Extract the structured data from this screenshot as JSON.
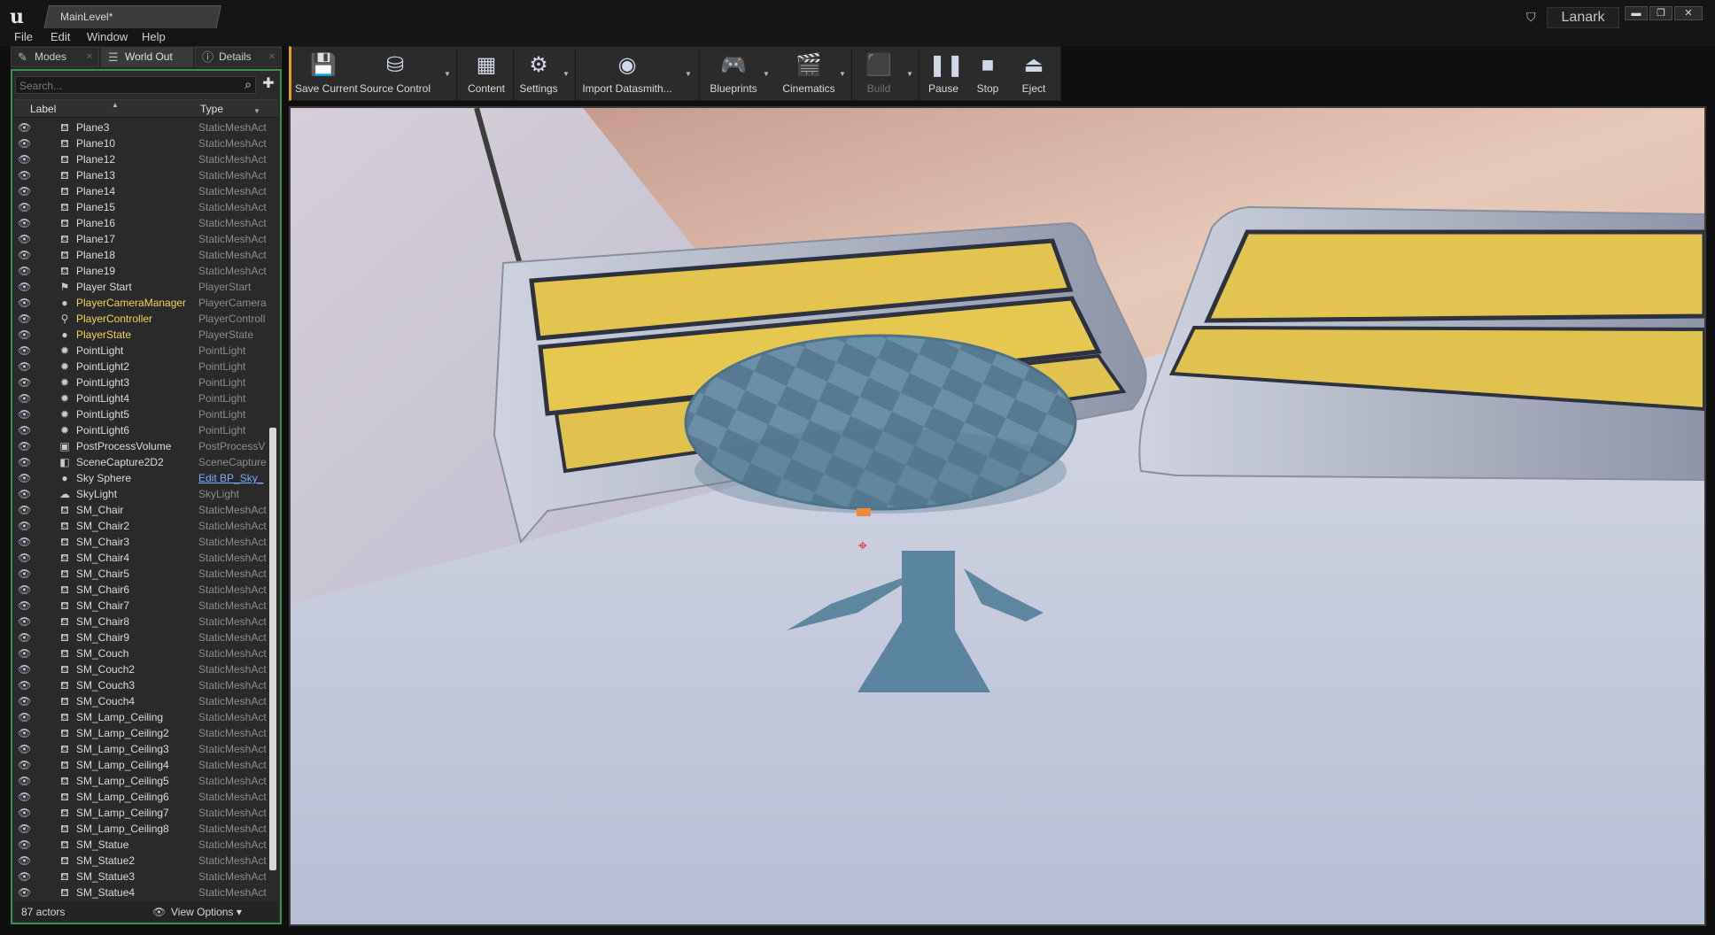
{
  "window": {
    "doc_tab": "MainLevel*",
    "project": "Lanark",
    "minimize": "▬",
    "maximize": "❐",
    "close": "✕"
  },
  "menu": [
    "File",
    "Edit",
    "Window",
    "Help"
  ],
  "panel_tabs": [
    {
      "label": "Modes",
      "icon": "modes-icon"
    },
    {
      "label": "World Out",
      "icon": "world-outliner-icon"
    },
    {
      "label": "Details",
      "icon": "details-icon"
    }
  ],
  "outliner": {
    "search_placeholder": "Search...",
    "col_label": "Label",
    "col_type": "Type",
    "rows": [
      {
        "label": "Plane3",
        "type": "StaticMeshAct",
        "icon": "mesh"
      },
      {
        "label": "Plane10",
        "type": "StaticMeshAct",
        "icon": "mesh"
      },
      {
        "label": "Plane12",
        "type": "StaticMeshAct",
        "icon": "mesh"
      },
      {
        "label": "Plane13",
        "type": "StaticMeshAct",
        "icon": "mesh"
      },
      {
        "label": "Plane14",
        "type": "StaticMeshAct",
        "icon": "mesh"
      },
      {
        "label": "Plane15",
        "type": "StaticMeshAct",
        "icon": "mesh"
      },
      {
        "label": "Plane16",
        "type": "StaticMeshAct",
        "icon": "mesh"
      },
      {
        "label": "Plane17",
        "type": "StaticMeshAct",
        "icon": "mesh"
      },
      {
        "label": "Plane18",
        "type": "StaticMeshAct",
        "icon": "mesh"
      },
      {
        "label": "Plane19",
        "type": "StaticMeshAct",
        "icon": "mesh"
      },
      {
        "label": "Player Start",
        "type": "PlayerStart",
        "icon": "playerstart"
      },
      {
        "label": "PlayerCameraManager",
        "type": "PlayerCamera",
        "icon": "sphere",
        "highlight": true
      },
      {
        "label": "PlayerController",
        "type": "PlayerControll",
        "icon": "controller",
        "highlight": true
      },
      {
        "label": "PlayerState",
        "type": "PlayerState",
        "icon": "sphere",
        "highlight": true
      },
      {
        "label": "PointLight",
        "type": "PointLight",
        "icon": "light"
      },
      {
        "label": "PointLight2",
        "type": "PointLight",
        "icon": "light"
      },
      {
        "label": "PointLight3",
        "type": "PointLight",
        "icon": "light"
      },
      {
        "label": "PointLight4",
        "type": "PointLight",
        "icon": "light"
      },
      {
        "label": "PointLight5",
        "type": "PointLight",
        "icon": "light"
      },
      {
        "label": "PointLight6",
        "type": "PointLight",
        "icon": "light"
      },
      {
        "label": "PostProcessVolume",
        "type": "PostProcessV",
        "icon": "volume"
      },
      {
        "label": "SceneCapture2D2",
        "type": "SceneCapture",
        "icon": "capture"
      },
      {
        "label": "Sky Sphere",
        "type": "Edit BP_Sky_",
        "icon": "sphere",
        "link": true
      },
      {
        "label": "SkyLight",
        "type": "SkyLight",
        "icon": "skylight"
      },
      {
        "label": "SM_Chair",
        "type": "StaticMeshAct",
        "icon": "mesh"
      },
      {
        "label": "SM_Chair2",
        "type": "StaticMeshAct",
        "icon": "mesh"
      },
      {
        "label": "SM_Chair3",
        "type": "StaticMeshAct",
        "icon": "mesh"
      },
      {
        "label": "SM_Chair4",
        "type": "StaticMeshAct",
        "icon": "mesh"
      },
      {
        "label": "SM_Chair5",
        "type": "StaticMeshAct",
        "icon": "mesh"
      },
      {
        "label": "SM_Chair6",
        "type": "StaticMeshAct",
        "icon": "mesh"
      },
      {
        "label": "SM_Chair7",
        "type": "StaticMeshAct",
        "icon": "mesh"
      },
      {
        "label": "SM_Chair8",
        "type": "StaticMeshAct",
        "icon": "mesh"
      },
      {
        "label": "SM_Chair9",
        "type": "StaticMeshAct",
        "icon": "mesh"
      },
      {
        "label": "SM_Couch",
        "type": "StaticMeshAct",
        "icon": "mesh"
      },
      {
        "label": "SM_Couch2",
        "type": "StaticMeshAct",
        "icon": "mesh"
      },
      {
        "label": "SM_Couch3",
        "type": "StaticMeshAct",
        "icon": "mesh"
      },
      {
        "label": "SM_Couch4",
        "type": "StaticMeshAct",
        "icon": "mesh"
      },
      {
        "label": "SM_Lamp_Ceiling",
        "type": "StaticMeshAct",
        "icon": "mesh"
      },
      {
        "label": "SM_Lamp_Ceiling2",
        "type": "StaticMeshAct",
        "icon": "mesh"
      },
      {
        "label": "SM_Lamp_Ceiling3",
        "type": "StaticMeshAct",
        "icon": "mesh"
      },
      {
        "label": "SM_Lamp_Ceiling4",
        "type": "StaticMeshAct",
        "icon": "mesh"
      },
      {
        "label": "SM_Lamp_Ceiling5",
        "type": "StaticMeshAct",
        "icon": "mesh"
      },
      {
        "label": "SM_Lamp_Ceiling6",
        "type": "StaticMeshAct",
        "icon": "mesh"
      },
      {
        "label": "SM_Lamp_Ceiling7",
        "type": "StaticMeshAct",
        "icon": "mesh"
      },
      {
        "label": "SM_Lamp_Ceiling8",
        "type": "StaticMeshAct",
        "icon": "mesh"
      },
      {
        "label": "SM_Statue",
        "type": "StaticMeshAct",
        "icon": "mesh"
      },
      {
        "label": "SM_Statue2",
        "type": "StaticMeshAct",
        "icon": "mesh"
      },
      {
        "label": "SM_Statue3",
        "type": "StaticMeshAct",
        "icon": "mesh"
      },
      {
        "label": "SM_Statue4",
        "type": "StaticMeshAct",
        "icon": "mesh"
      }
    ],
    "actor_count": "87 actors",
    "view_options": "View Options"
  },
  "toolbar": [
    {
      "label": "Save Current",
      "icon": "save-icon",
      "dropdown": false
    },
    {
      "label": "Source Control",
      "icon": "source-control-icon",
      "dropdown": true
    },
    {
      "label": "Content",
      "icon": "content-icon",
      "dropdown": false
    },
    {
      "label": "Settings",
      "icon": "settings-icon",
      "dropdown": true
    },
    {
      "label": "Import Datasmith...",
      "icon": "datasmith-icon",
      "dropdown": true
    },
    {
      "label": "Blueprints",
      "icon": "blueprints-icon",
      "dropdown": true
    },
    {
      "label": "Cinematics",
      "icon": "cinematics-icon",
      "dropdown": true
    },
    {
      "label": "Build",
      "icon": "build-icon",
      "dropdown": true,
      "disabled": true
    },
    {
      "label": "Pause",
      "icon": "pause-icon",
      "dropdown": false
    },
    {
      "label": "Stop",
      "icon": "stop-icon",
      "dropdown": false
    },
    {
      "label": "Eject",
      "icon": "eject-icon",
      "dropdown": false
    }
  ],
  "colors": {
    "accent_outline": "#3f8f4a",
    "toolbar_accent": "#e3a01b",
    "highlight_text": "#f3d35a",
    "couch_yellow": "#e3c44f",
    "table_blue": "#5d87a0"
  }
}
